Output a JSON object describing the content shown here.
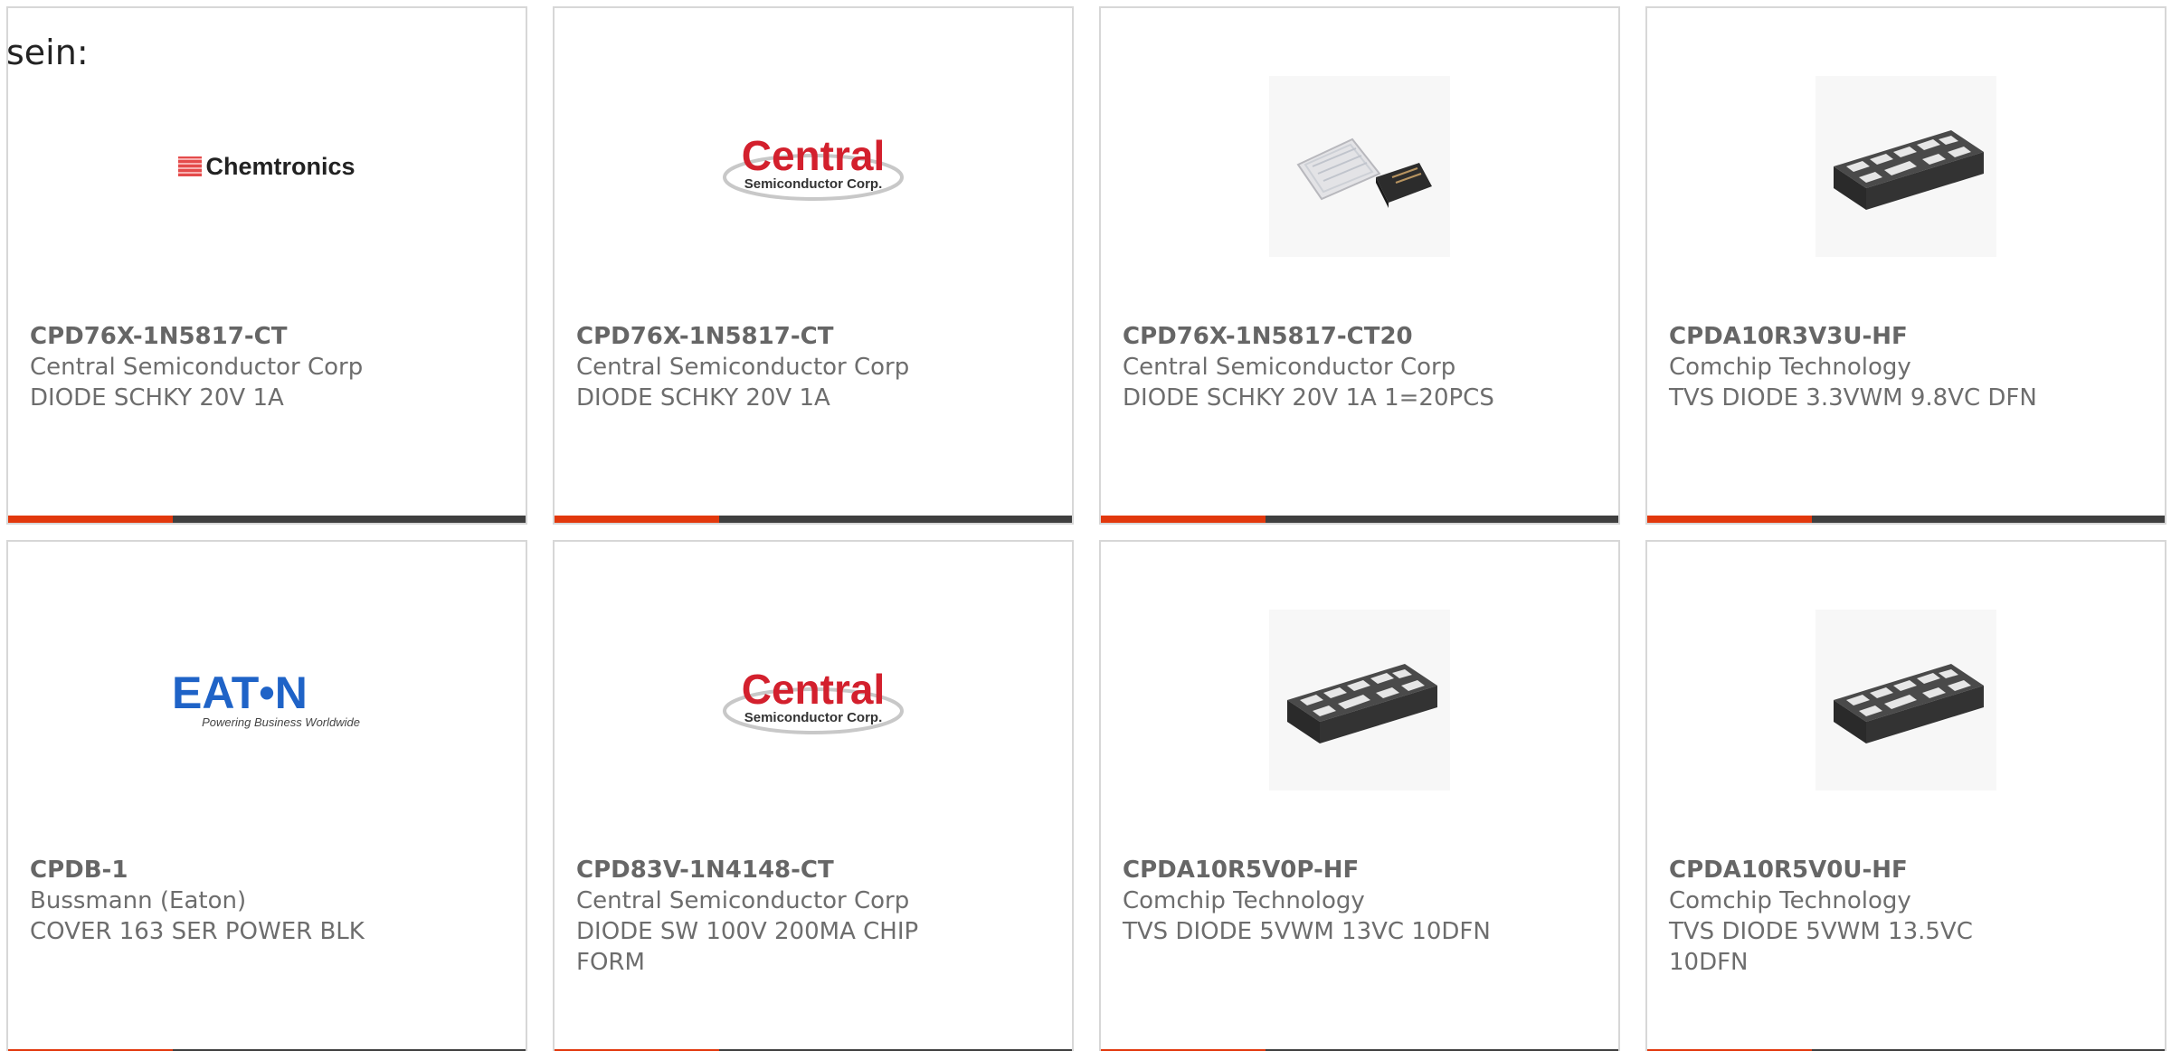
{
  "intro_text": "sein:",
  "products": [
    {
      "part_number": "CPD76X-1N5817-CT",
      "manufacturer": "Central Semiconductor Corp",
      "description": "DIODE SCHKY 20V 1A",
      "image": "chemtronics-logo"
    },
    {
      "part_number": "CPD76X-1N5817-CT",
      "manufacturer": "Central Semiconductor Corp",
      "description": "DIODE SCHKY 20V 1A",
      "image": "central-semiconductor-logo"
    },
    {
      "part_number": "CPD76X-1N5817-CT20",
      "manufacturer": "Central Semiconductor Corp",
      "description": "DIODE SCHKY 20V 1A 1=20PCS",
      "image": "diode-pack-photo"
    },
    {
      "part_number": "CPDA10R3V3U-HF",
      "manufacturer": "Comchip Technology",
      "description": "TVS DIODE 3.3VWM 9.8VC DFN",
      "image": "dfn-chip-photo"
    },
    {
      "part_number": "CPDB-1",
      "manufacturer": "Bussmann (Eaton)",
      "description": "COVER 163 SER POWER BLK",
      "image": "eaton-logo"
    },
    {
      "part_number": "CPD83V-1N4148-CT",
      "manufacturer": "Central Semiconductor Corp",
      "description": "DIODE SW 100V 200MA CHIP FORM",
      "image": "central-semiconductor-logo"
    },
    {
      "part_number": "CPDA10R5V0P-HF",
      "manufacturer": "Comchip Technology",
      "description": "TVS DIODE 5VWM 13VC 10DFN",
      "image": "dfn-chip-photo"
    },
    {
      "part_number": "CPDA10R5V0U-HF",
      "manufacturer": "Comchip Technology",
      "description": "TVS DIODE 5VWM 13.5VC 10DFN",
      "image": "dfn-chip-photo"
    }
  ],
  "logos": {
    "chemtronics": "Chemtronics",
    "central_main": "Central",
    "central_sub": "Semiconductor Corp.",
    "eaton_main": "EAT•N",
    "eaton_sub": "Powering Business Worldwide"
  },
  "colors": {
    "accent": "#e2380d",
    "bar": "#3f3f3f",
    "central_red": "#d3202d",
    "eaton_blue": "#1f63c7"
  }
}
